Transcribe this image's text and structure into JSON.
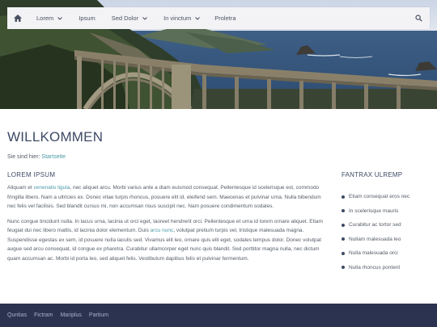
{
  "nav": {
    "items": [
      {
        "label": "Lorem",
        "has_dropdown": true
      },
      {
        "label": "Ipsum",
        "has_dropdown": false
      },
      {
        "label": "Sed Dolor",
        "has_dropdown": true
      },
      {
        "label": "In vinctum",
        "has_dropdown": true
      },
      {
        "label": "Proletra",
        "has_dropdown": false
      }
    ],
    "home_icon": "home-icon",
    "search_icon": "search-icon"
  },
  "hero": {
    "image": "coastal-arch-bridge-photo"
  },
  "page": {
    "title": "WILLKOMMEN",
    "breadcrumb_prefix": "Sie sind hier: ",
    "breadcrumb_link": "Startseite"
  },
  "main": {
    "heading": "LOREM IPSUM",
    "p1_a": "Aliquam et ",
    "p1_link": "venenatis ligula",
    "p1_b": ", nec aliquet arcu. Morbi varius ante a diam euismod consequat. Pellentesque id scelerisque est, commodo fringilla libero. Nam a ultricies ex. Donec vitae turpis rhoncus, posuere elit id, eleifend sem. Maecenas et pulvinar urna. Nulla bibendum nec felis vel facilisis. Sed blandit cursus mi, non accumsan risus suscipit nec. Nam posuere condimentum sodales.",
    "p2_a": "Nunc congue tincidunt nulla. In lacus urna, lacinia ut orci eget, laoreet hendrerit orci. Pellentesque et urna id lorem ornare aliquet. Etiam feugiat dui nec libero mattis, id lacinia dolor elementum. Duis ",
    "p2_link": "arcu nunc",
    "p2_b": ", volutpat pretium turpis vel, tristique malesuada magna. Suspendisse egestas ex sem, id posuere nulla iaculis sed. Vivamus elit leo, ornare quis elit eget, sodales tempus dolor. Donec volutpat augue sed arcu consequat, id congue ex pharetra. Curabitur ullamcorper eget nunc quis blandit. Sed porttitor magna nulla, nec dictum quam accumsan ac. Morbi id porta leo, sed aliquet felis. Vestibulum dapibus felis et pulvinar fermentum."
  },
  "sidebar": {
    "heading": "FANTRAX ULREMP",
    "items": [
      "Etiam consequat eros nec",
      "In scelerisque mauris",
      "Curabitur ac tortor sed",
      "Nullam malesuada leo",
      "Nulla malesuada orci",
      "Nulla rhoncus pontent"
    ]
  },
  "footer": {
    "links": [
      "Quntias",
      "Fictram",
      "Mariplus",
      "Partium"
    ]
  },
  "colors": {
    "nav_bg": "#f3f3f6",
    "title": "#3d4a66",
    "link": "#4a9aa8",
    "footer_bg": "#2c3350",
    "footer_link": "#a8b0d0"
  }
}
